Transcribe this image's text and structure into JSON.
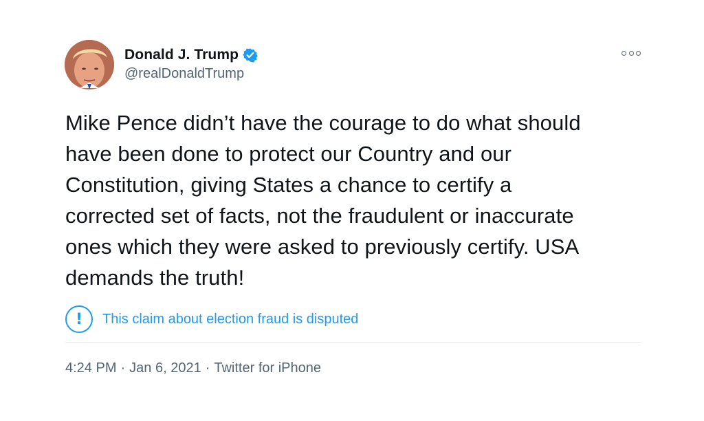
{
  "author": {
    "display_name": "Donald J. Trump",
    "handle": "@realDonaldTrump",
    "avatar_icon": "profile-photo",
    "verified_icon": "verified-badge-icon"
  },
  "tweet": {
    "lines": [
      "Mike Pence didn’t have the courage to do what should",
      "have been done to protect our Country and our",
      "Constitution, giving States a chance to certify a",
      "corrected set of facts, not the fraudulent or inaccurate",
      "ones which they were asked to previously certify. USA",
      "demands the truth!"
    ]
  },
  "notice": {
    "icon_symbol": "!",
    "text": "This claim about election fraud is disputed"
  },
  "meta": {
    "time": "4:24 PM",
    "sep1": "·",
    "date": "Jan 6, 2021",
    "sep2": "·",
    "source": "Twitter for iPhone"
  },
  "colors": {
    "accent": "#1d9bf0",
    "text": "#0f1419",
    "secondary": "#536471"
  }
}
